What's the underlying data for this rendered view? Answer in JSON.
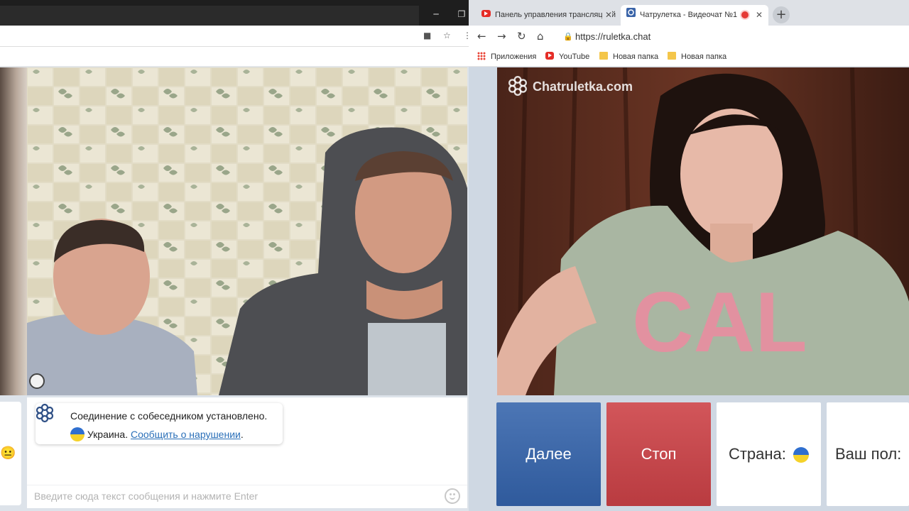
{
  "left_window": {
    "chat": {
      "system_message_line1": "Соединение с собеседником установлено.",
      "country": "Украина.",
      "report_link": "Сообщить о нарушении",
      "report_suffix": ".",
      "input_placeholder": "Введите сюда текст сообщения и нажмите Enter"
    },
    "window_controls": [
      "─",
      "❐"
    ]
  },
  "right_window": {
    "tabs": [
      {
        "title": "Панель управления трансляцией",
        "icon": "youtube-icon"
      },
      {
        "title": "Чатрулетка - Видеочат №1",
        "icon": "chatroulette-icon",
        "recording": true
      }
    ],
    "url": "https://ruletka.chat",
    "bookmarks": [
      {
        "label": "Приложения",
        "icon": "apps-icon"
      },
      {
        "label": "YouTube",
        "icon": "youtube-icon"
      },
      {
        "label": "Новая папка",
        "icon": "folder-icon"
      },
      {
        "label": "Новая папка",
        "icon": "folder-icon"
      }
    ],
    "watermark": "Chatruletka.com",
    "buttons": {
      "next": "Далее",
      "stop": "Стоп",
      "country": "Страна:",
      "gender": "Ваш пол:"
    }
  },
  "colors": {
    "next_button": "#3d67a8",
    "stop_button": "#c4474b",
    "link": "#2a6fb8",
    "ukraine_blue": "#2f6fcf",
    "ukraine_yellow": "#f5d22a"
  }
}
